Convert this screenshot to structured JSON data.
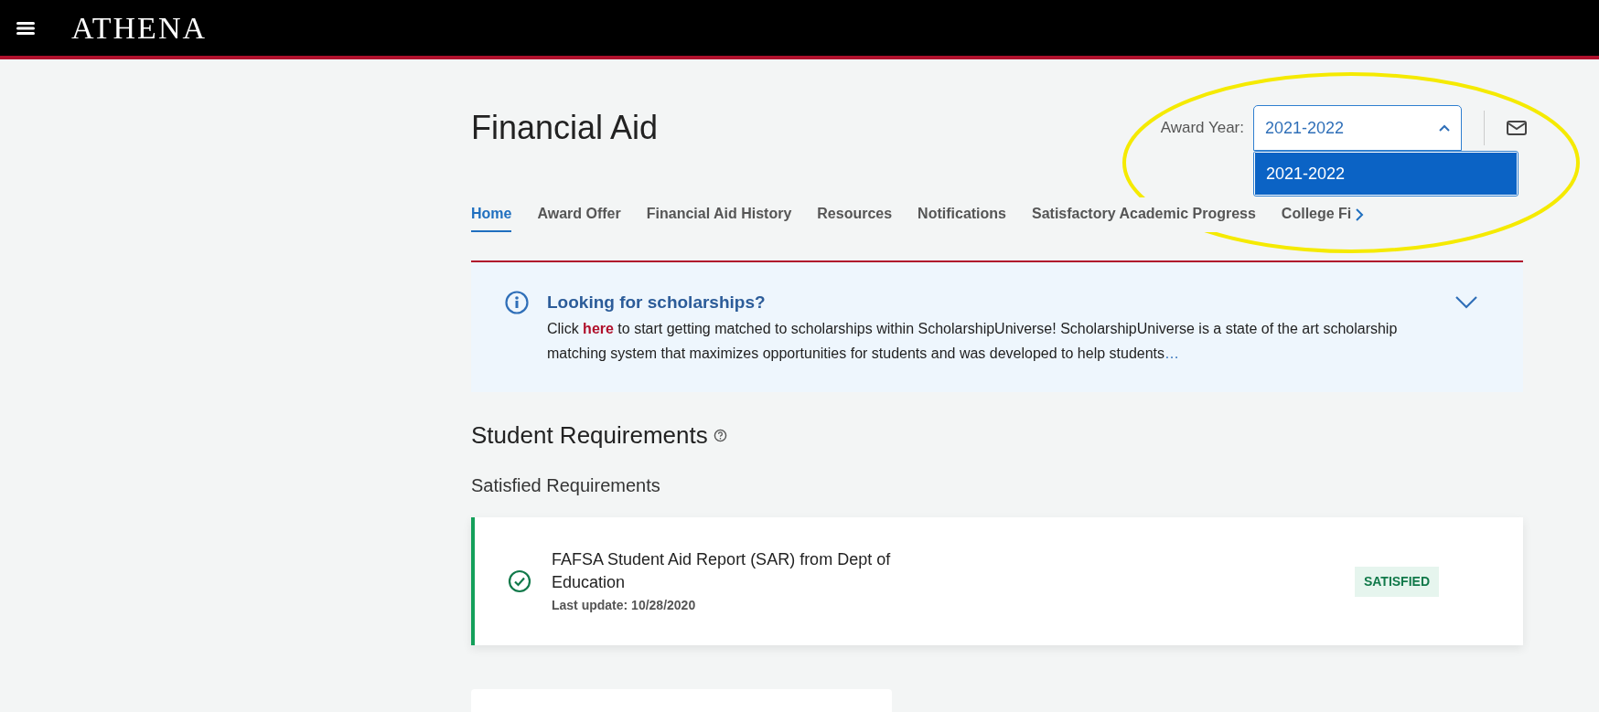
{
  "header": {
    "brand": "ATHENA"
  },
  "page": {
    "title": "Financial Aid"
  },
  "award_year": {
    "label": "Award Year:",
    "value": "2021-2022",
    "expanded": true,
    "options": [
      {
        "label": "2021-2022",
        "selected": true
      }
    ]
  },
  "tabs": [
    {
      "label": "Home",
      "selected": true
    },
    {
      "label": "Award Offer",
      "selected": false
    },
    {
      "label": "Financial Aid History",
      "selected": false
    },
    {
      "label": "Resources",
      "selected": false
    },
    {
      "label": "Notifications",
      "selected": false
    },
    {
      "label": "Satisfactory Academic Progress",
      "selected": false
    },
    {
      "label": "College Fi",
      "selected": false
    }
  ],
  "banner": {
    "title": "Looking for scholarships?",
    "text_before": "Click ",
    "link": "here",
    "text_after": " to start getting matched to scholarships within ScholarshipUniverse! ScholarshipUniverse is a state of the art scholarship matching system that maximizes opportunities for students and was developed to help students",
    "more": "…",
    "expanded": false
  },
  "requirements": {
    "title": "Student Requirements",
    "subtitle": "Satisfied Requirements",
    "items": [
      {
        "title": "FAFSA Student Aid Report (SAR) from Dept of Education",
        "updated": "Last update: 10/28/2020",
        "status": "SATISFIED",
        "satisfied": true
      }
    ]
  }
}
